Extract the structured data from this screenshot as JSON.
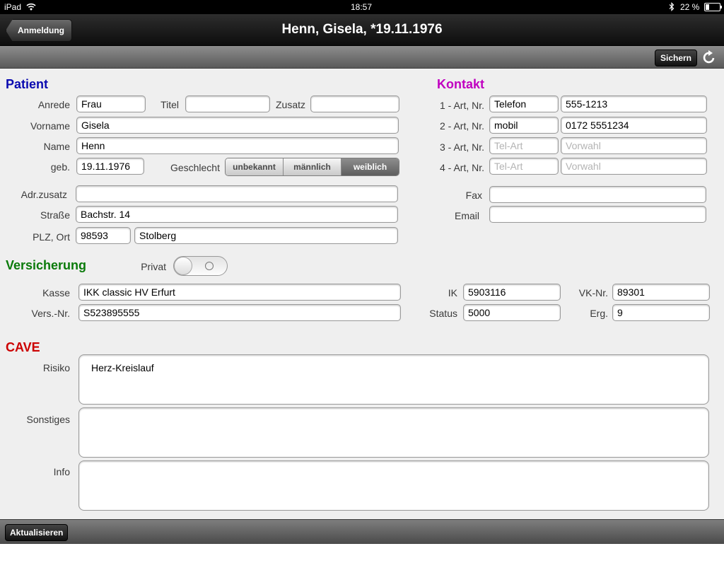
{
  "status": {
    "device": "iPad",
    "time": "18:57",
    "battery": "22 %"
  },
  "nav": {
    "back_label": "Anmeldung",
    "title": "Henn, Gisela, *19.11.1976"
  },
  "toolbar": {
    "save_label": "Sichern",
    "refresh_icon": "refresh-icon"
  },
  "patient": {
    "heading": "Patient",
    "anrede_label": "Anrede",
    "anrede": "Frau",
    "titel_label": "Titel",
    "titel": "",
    "zusatz_label": "Zusatz",
    "zusatz": "",
    "vorname_label": "Vorname",
    "vorname": "Gisela",
    "name_label": "Name",
    "name": "Henn",
    "geb_label": "geb.",
    "geb": "19.11.1976",
    "geschlecht_label": "Geschlecht",
    "geschlecht_options": [
      "unbekannt",
      "männlich",
      "weiblich"
    ],
    "geschlecht_selected": "weiblich",
    "adrzusatz_label": "Adr.zusatz",
    "adrzusatz": "",
    "strasse_label": "Straße",
    "strasse": "Bachstr. 14",
    "plzort_label": "PLZ, Ort",
    "plz": "98593",
    "ort": "Stolberg"
  },
  "kontakt": {
    "heading": "Kontakt",
    "rows": [
      {
        "label": "1 - Art, Nr.",
        "art": "Telefon",
        "nr": "555-1213"
      },
      {
        "label": "2 - Art, Nr.",
        "art": "mobil",
        "nr": "0172 5551234"
      },
      {
        "label": "3 - Art, Nr.",
        "art_placeholder": "Tel-Art",
        "nr_placeholder": "Vorwahl"
      },
      {
        "label": "4 - Art, Nr.",
        "art_placeholder": "Tel-Art",
        "nr_placeholder": "Vorwahl"
      }
    ],
    "fax_label": "Fax",
    "fax": "",
    "email_label": "Email",
    "email": ""
  },
  "versicherung": {
    "heading": "Versicherung",
    "privat_label": "Privat",
    "privat": false,
    "kasse_label": "Kasse",
    "kasse": "IKK classic HV Erfurt",
    "versnr_label": "Vers.-Nr.",
    "versnr": "S523895555",
    "ik_label": "IK",
    "ik": "5903116",
    "status_label": "Status",
    "status": "5000",
    "vknr_label": "VK-Nr.",
    "vknr": "89301",
    "erg_label": "Erg.",
    "erg": "9"
  },
  "cave": {
    "heading": "CAVE",
    "risiko_label": "Risiko",
    "risiko": "Herz-Kreislauf",
    "sonstiges_label": "Sonstiges",
    "sonstiges": "",
    "info_label": "Info",
    "info": ""
  },
  "bottom": {
    "update_label": "Aktualisieren"
  },
  "colors": {
    "patient": "#0a0ab0",
    "kontakt": "#c000c0",
    "versicherung": "#0a7a0a",
    "cave": "#cc0000"
  }
}
